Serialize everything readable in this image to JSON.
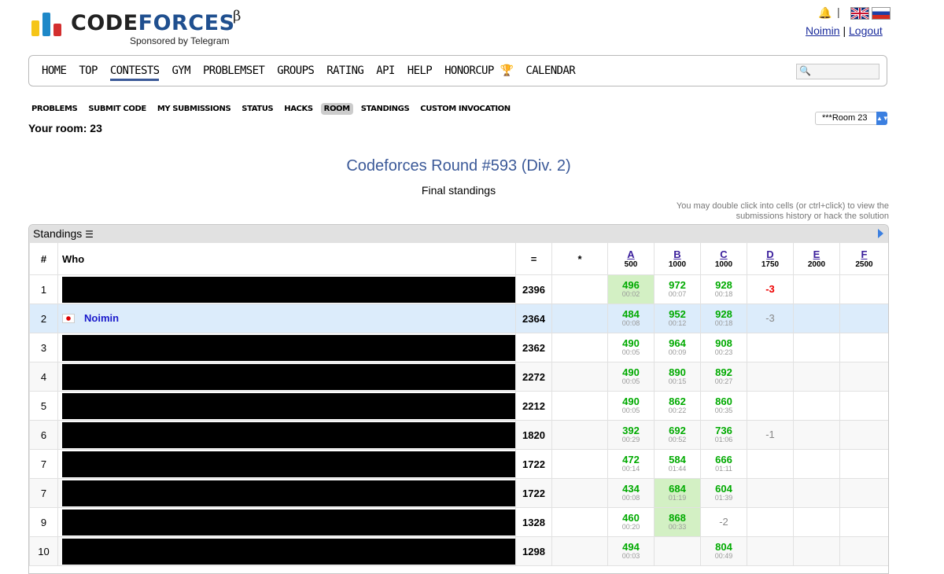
{
  "header": {
    "logo_first": "CODE",
    "logo_second": "FORCES",
    "beta": "β",
    "sponsor": "Sponsored by Telegram",
    "user": "Noimin",
    "logout": "Logout",
    "divider": "|"
  },
  "nav": {
    "items": [
      "HOME",
      "TOP",
      "CONTESTS",
      "GYM",
      "PROBLEMSET",
      "GROUPS",
      "RATING",
      "API",
      "HELP",
      "HONORCUP",
      "CALENDAR"
    ],
    "active": "CONTESTS"
  },
  "subnav": {
    "items": [
      "PROBLEMS",
      "SUBMIT CODE",
      "MY SUBMISSIONS",
      "STATUS",
      "HACKS",
      "ROOM",
      "STANDINGS",
      "CUSTOM INVOCATION"
    ],
    "selected": "ROOM"
  },
  "room": {
    "label": "Your room: 23",
    "select_value": "***Room 23"
  },
  "contest": {
    "title": "Codeforces Round #593 (Div. 2)",
    "subtitle": "Final standings",
    "hint_line1": "You may double click into cells (or ctrl+click) to view the",
    "hint_line2": "submissions history or hack the solution"
  },
  "standings": {
    "label": "Standings",
    "columns": {
      "rank": "#",
      "who": "Who",
      "score": "=",
      "hacks": "*"
    },
    "problems": [
      {
        "letter": "A",
        "points": "500"
      },
      {
        "letter": "B",
        "points": "1000"
      },
      {
        "letter": "C",
        "points": "1000"
      },
      {
        "letter": "D",
        "points": "1750"
      },
      {
        "letter": "E",
        "points": "2000"
      },
      {
        "letter": "F",
        "points": "2500"
      }
    ],
    "rows": [
      {
        "rank": "1",
        "who": "",
        "score": "2396",
        "cells": [
          [
            "496",
            "00:02",
            "first"
          ],
          [
            "972",
            "00:07"
          ],
          [
            "928",
            "00:18"
          ],
          [
            "-3",
            "",
            "fail-red"
          ],
          [],
          []
        ]
      },
      {
        "rank": "2",
        "who": "Noimin",
        "score": "2364",
        "cells": [
          [
            "484",
            "00:08"
          ],
          [
            "952",
            "00:12"
          ],
          [
            "928",
            "00:18"
          ],
          [
            "-3",
            "",
            "fail-grey"
          ],
          [],
          []
        ]
      },
      {
        "rank": "3",
        "who": "",
        "score": "2362",
        "cells": [
          [
            "490",
            "00:05"
          ],
          [
            "964",
            "00:09"
          ],
          [
            "908",
            "00:23"
          ],
          [],
          [],
          []
        ]
      },
      {
        "rank": "4",
        "who": "",
        "score": "2272",
        "cells": [
          [
            "490",
            "00:05"
          ],
          [
            "890",
            "00:15"
          ],
          [
            "892",
            "00:27"
          ],
          [],
          [],
          []
        ]
      },
      {
        "rank": "5",
        "who": "",
        "score": "2212",
        "cells": [
          [
            "490",
            "00:05"
          ],
          [
            "862",
            "00:22"
          ],
          [
            "860",
            "00:35"
          ],
          [],
          [],
          []
        ]
      },
      {
        "rank": "6",
        "who": "",
        "score": "1820",
        "cells": [
          [
            "392",
            "00:29"
          ],
          [
            "692",
            "00:52"
          ],
          [
            "736",
            "01:06"
          ],
          [
            "-1",
            "",
            "fail-grey"
          ],
          [],
          []
        ]
      },
      {
        "rank": "7",
        "who": "",
        "score": "1722",
        "cells": [
          [
            "472",
            "00:14"
          ],
          [
            "584",
            "01:44"
          ],
          [
            "666",
            "01:11"
          ],
          [],
          [],
          []
        ]
      },
      {
        "rank": "7",
        "who": "",
        "score": "1722",
        "cells": [
          [
            "434",
            "00:08"
          ],
          [
            "684",
            "01:19",
            "first"
          ],
          [
            "604",
            "01:39"
          ],
          [],
          [],
          []
        ]
      },
      {
        "rank": "9",
        "who": "",
        "score": "1328",
        "cells": [
          [
            "460",
            "00:20"
          ],
          [
            "868",
            "00:33",
            "first"
          ],
          [
            "-2",
            "",
            "fail-grey"
          ],
          [],
          [],
          []
        ]
      },
      {
        "rank": "10",
        "who": "",
        "score": "1298",
        "cells": [
          [
            "494",
            "00:03"
          ],
          [],
          [
            "804",
            "00:49"
          ],
          [],
          [],
          []
        ]
      }
    ]
  },
  "colors": {
    "accent": "#3b5998",
    "accepted": "#00aa00",
    "first_solve_bg": "#d3f0c4",
    "highlight_row": "#dcecfb"
  }
}
